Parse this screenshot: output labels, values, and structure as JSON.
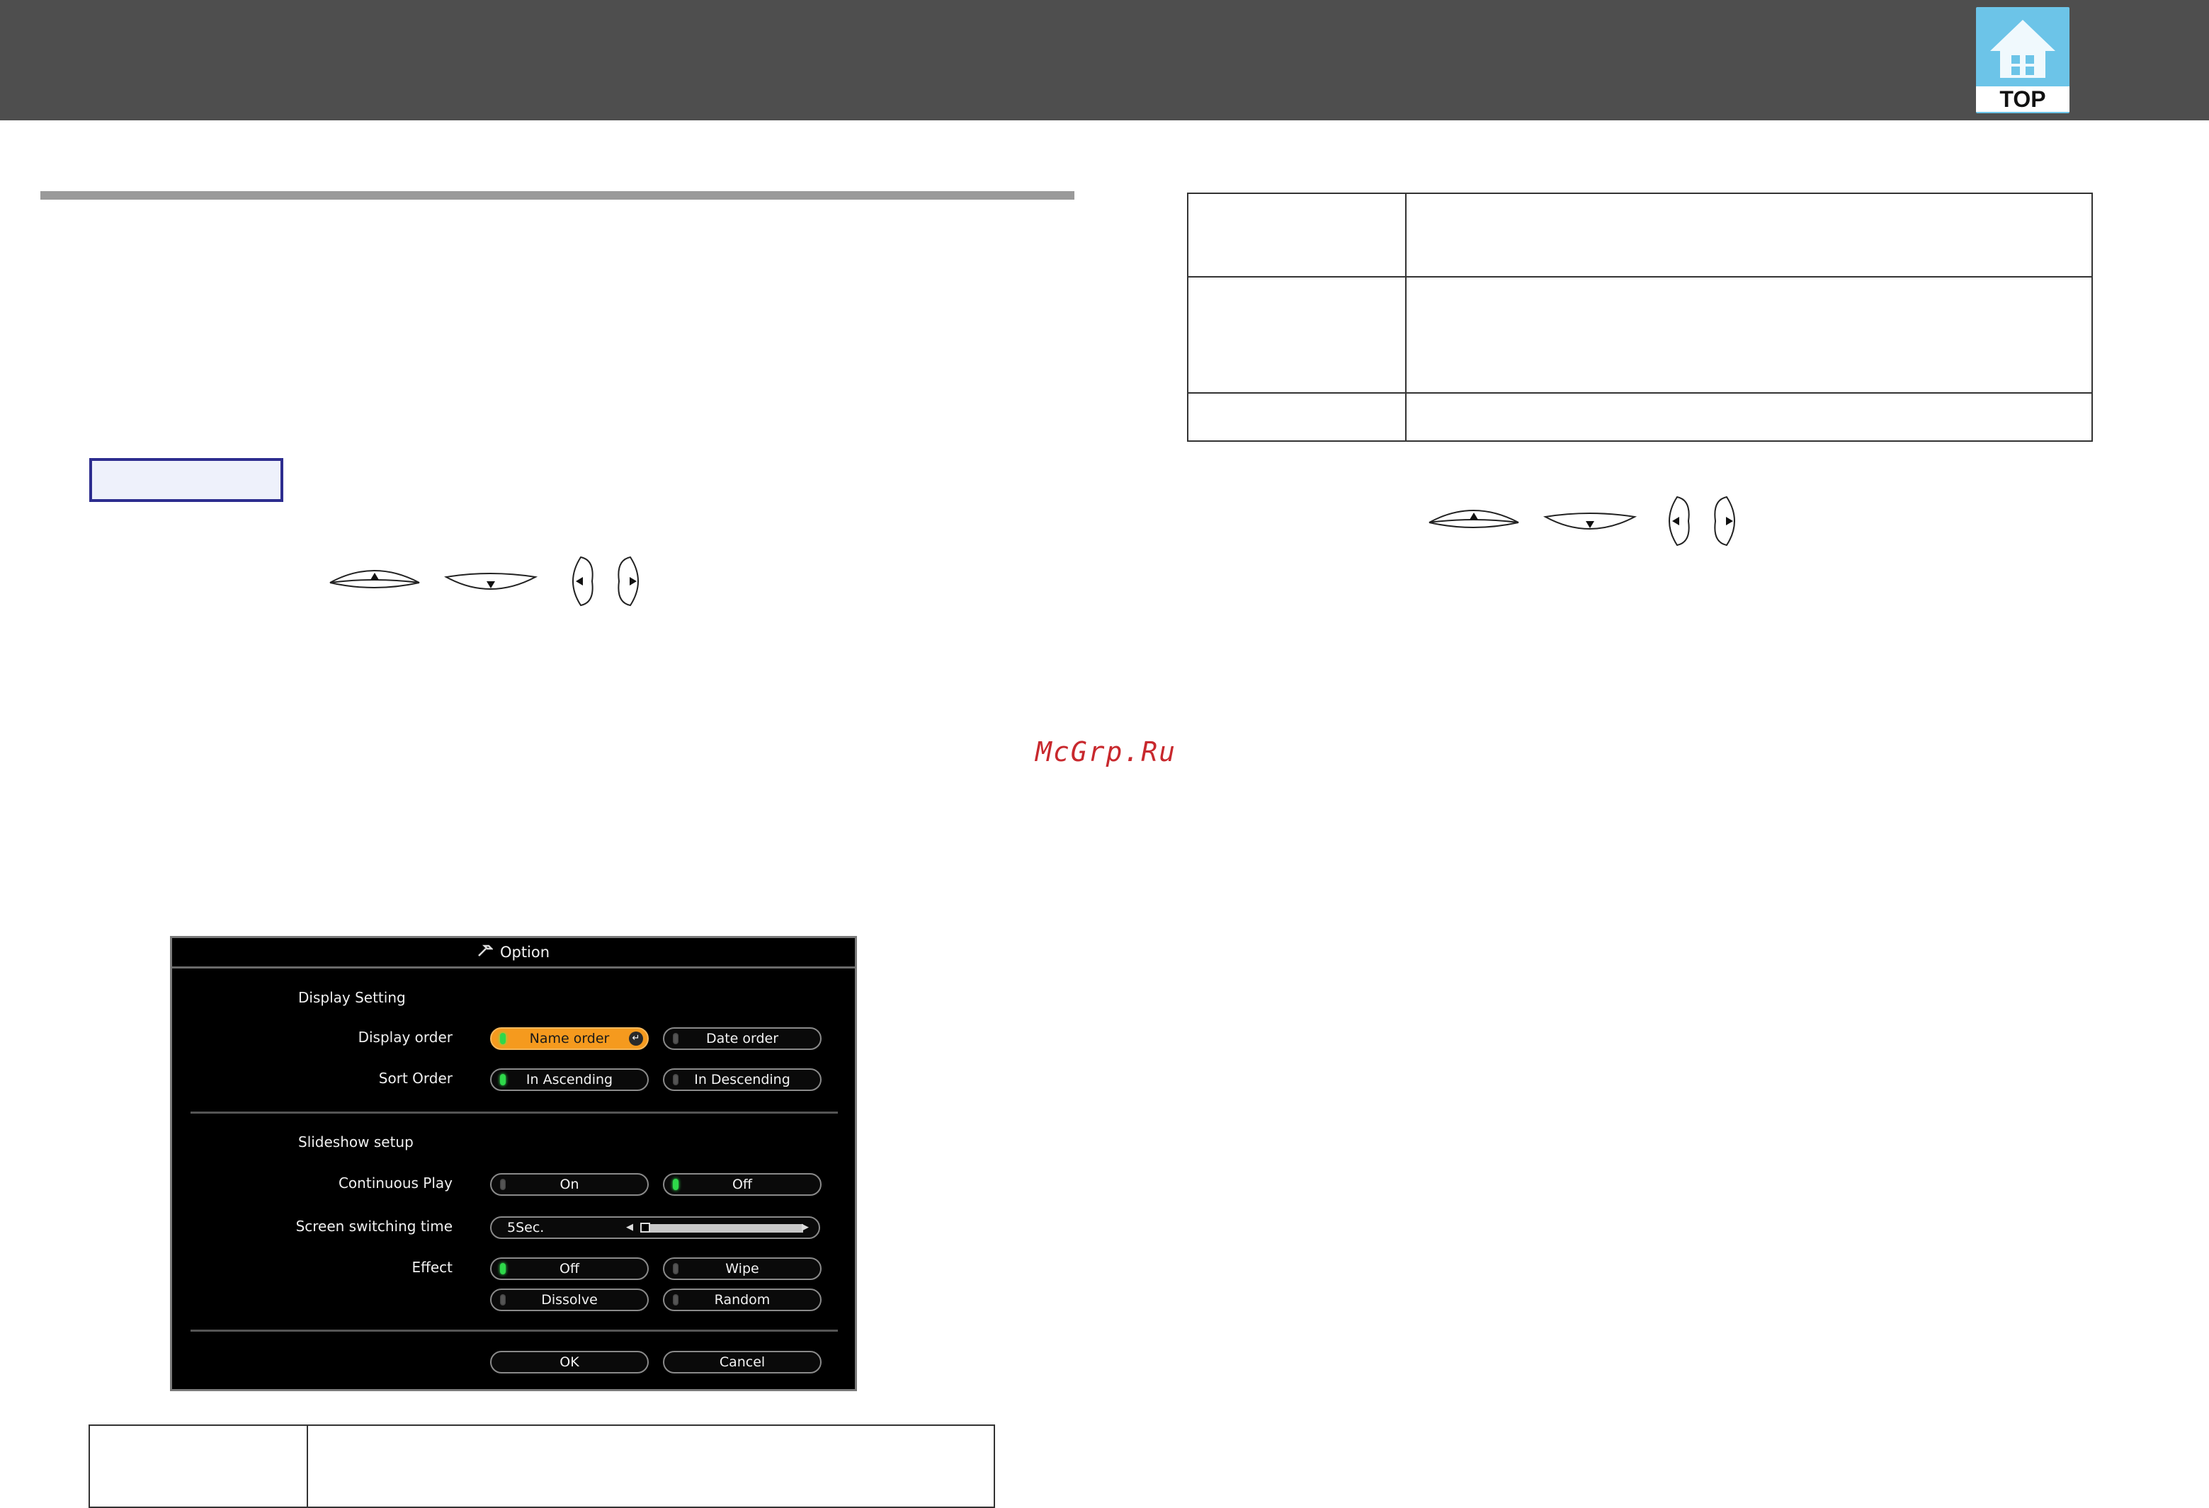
{
  "header": {
    "top_button_label": "TOP",
    "top_icon": "house-icon"
  },
  "watermark": "McGrp.Ru",
  "keys_left": [
    "up-arrow-key",
    "down-arrow-key",
    "left-arrow-key",
    "right-arrow-key"
  ],
  "keys_right": [
    "up-arrow-key",
    "down-arrow-key",
    "left-arrow-key",
    "right-arrow-key"
  ],
  "dialog": {
    "title": "Option",
    "title_icon": "wrench-icon",
    "display_setting": {
      "heading": "Display Setting",
      "display_order_label": "Display order",
      "name_order": "Name order",
      "date_order": "Date order",
      "sort_order_label": "Sort Order",
      "in_ascending": "In Ascending",
      "in_descending": "In Descending"
    },
    "slideshow": {
      "heading": "Slideshow setup",
      "continuous_play_label": "Continuous Play",
      "on": "On",
      "off": "Off",
      "switching_time_label": "Screen switching time",
      "switching_time_value": "5Sec.",
      "switching_time_level": 0.0,
      "effect_label": "Effect",
      "effect_off": "Off",
      "effect_wipe": "Wipe",
      "effect_dissolve": "Dissolve",
      "effect_random": "Random"
    },
    "ok": "OK",
    "cancel": "Cancel"
  },
  "colors": {
    "header": "#4e4e4e",
    "accent_orange": "#f59a1e",
    "led_on": "#2ed84a",
    "procedure_border": "#2d2d8f",
    "watermark": "#c8282d"
  }
}
